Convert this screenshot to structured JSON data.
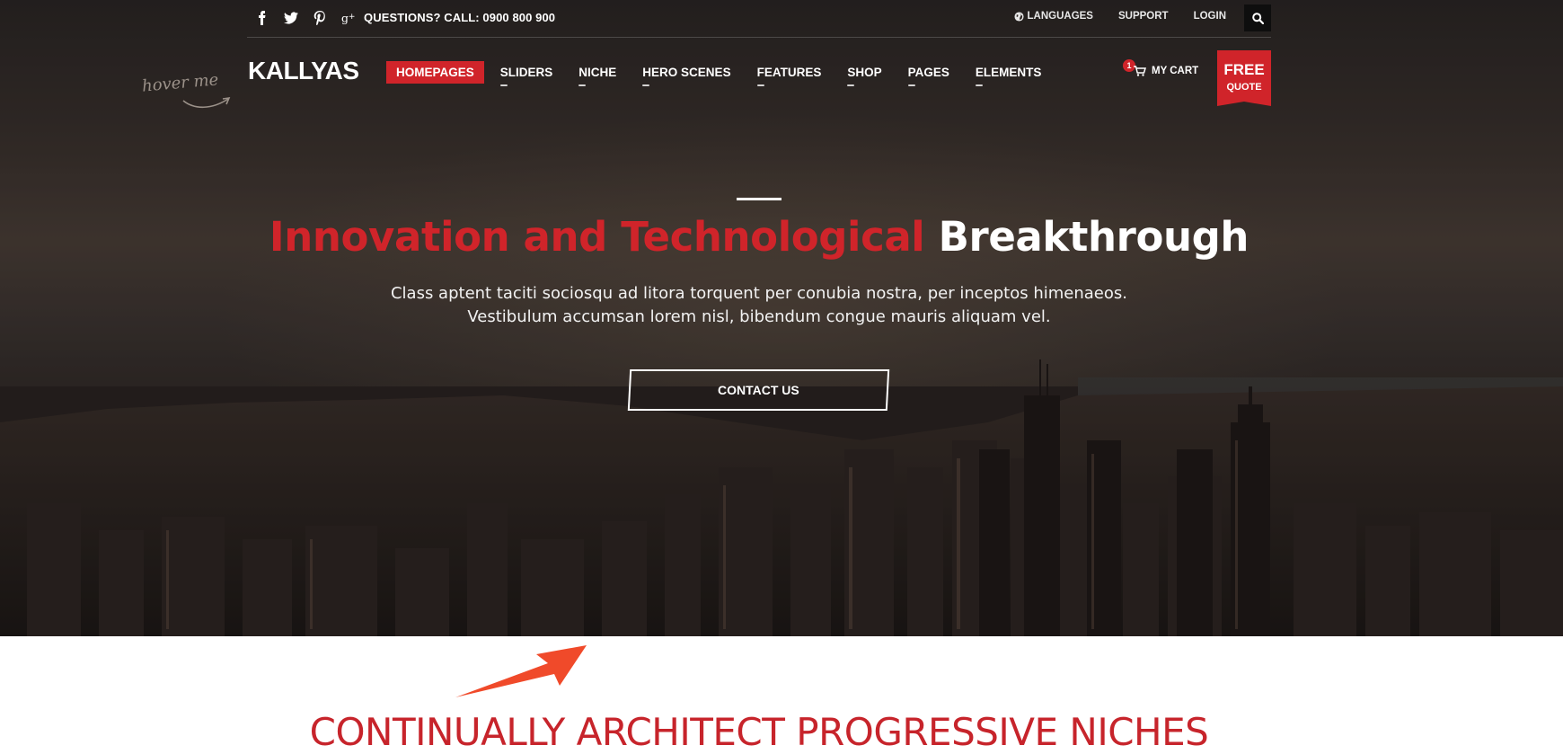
{
  "topbar": {
    "social": [
      "facebook-icon",
      "twitter-icon",
      "pinterest-icon",
      "google-plus-icon"
    ],
    "phone": "QUESTIONS? CALL: 0900 800 900",
    "links": {
      "languages": "LANGUAGES",
      "support": "SUPPORT",
      "login": "LOGIN"
    },
    "search_icon": "search-icon"
  },
  "header": {
    "logo": "KALLYAS",
    "hover_hint": "hover me",
    "nav": [
      {
        "label": "HOMEPAGES",
        "active": true
      },
      {
        "label": "SLIDERS"
      },
      {
        "label": "NICHE"
      },
      {
        "label": "HERO SCENES"
      },
      {
        "label": "FEATURES"
      },
      {
        "label": "SHOP"
      },
      {
        "label": "PAGES"
      },
      {
        "label": "ELEMENTS"
      }
    ],
    "cart": {
      "count": "1",
      "label": "MY CART"
    },
    "quote": {
      "line1": "FREE",
      "line2": "QUOTE"
    }
  },
  "hero": {
    "headline_red": "Innovation and Technological",
    "headline_white": "Breakthrough",
    "sub_line1": "Class aptent taciti sociosqu ad litora torquent per conubia nostra, per inceptos himenaeos.",
    "sub_line2": "Vestibulum accumsan lorem nisl, bibendum congue mauris aliquam vel.",
    "cta": "CONTACT US"
  },
  "section": {
    "title": "CONTINUALLY ARCHITECT PROGRESSIVE NICHES"
  },
  "colors": {
    "accent": "#d0242a",
    "topbar_search_bg": "#0e0e0e",
    "arrow": "#f04a2a"
  }
}
